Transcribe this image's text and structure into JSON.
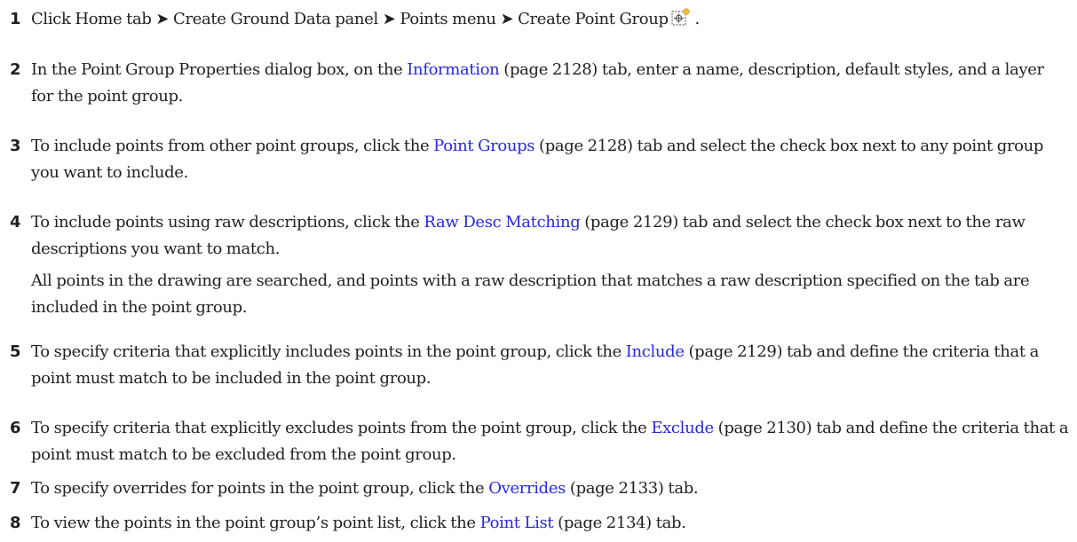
{
  "steps": [
    {
      "number": "1",
      "before": "Click Home tab ➤ Create Ground Data panel ➤ Points menu ➤ Create Point Group",
      "icon": "create-point-group-icon",
      "after": "."
    },
    {
      "number": "2",
      "before": "In the Point Group Properties dialog box, on the ",
      "link": "Information",
      "page_ref": " (page 2128)",
      "after": " tab, enter a name, description, default styles, and a layer for the point group."
    },
    {
      "number": "3",
      "before": "To include points from other point groups, click the ",
      "link": "Point Groups",
      "page_ref": " (page 2128)",
      "after": " tab and select the check box next to any point group you want to include."
    },
    {
      "number": "4",
      "before": "To include points using raw descriptions, click the ",
      "link": "Raw Desc Matching",
      "page_ref": " (page 2129)",
      "after": " tab and select the check box next to the raw descriptions you want to match.",
      "note": "All points in the drawing are searched, and points with a raw description that matches a raw description specified on the tab are included in the point group."
    },
    {
      "number": "5",
      "before": "To specify criteria that explicitly includes points in the point group, click the ",
      "link": "Include",
      "page_ref": " (page 2129)",
      "after": " tab and define the criteria that a point must match to be included in the point group."
    },
    {
      "number": "6",
      "before": "To specify criteria that explicitly excludes points from the point group, click the ",
      "link": "Exclude",
      "page_ref": " (page 2130)",
      "after": " tab and define the criteria that a point must match to be excluded from the point group."
    },
    {
      "number": "7",
      "before": "To specify overrides for points in the point group, click the ",
      "link": "Overrides",
      "page_ref": " (page 2133)",
      "after": " tab."
    },
    {
      "number": "8",
      "before": "To view the points in the point group’s point list, click the ",
      "link": "Point List",
      "page_ref": " (page 2134)",
      "after": " tab."
    }
  ],
  "colors": {
    "text": "#231f20",
    "link": "#2a2ad2",
    "icon_accent": "#e8a020"
  }
}
